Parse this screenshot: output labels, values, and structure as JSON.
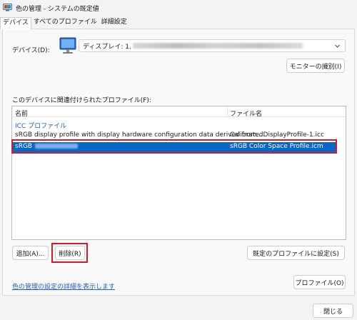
{
  "window": {
    "title": "色の管理 - システムの既定値"
  },
  "tabs": [
    {
      "label": "デバイス"
    },
    {
      "label": "すべてのプロファイル"
    },
    {
      "label": "詳細設定"
    }
  ],
  "device": {
    "label": "デバイス(D):",
    "value": "ディスプレイ: 1.",
    "identify_button": "モニターの識別(I)"
  },
  "profiles": {
    "label": "このデバイスに関連付けられたプロファイル(F):",
    "columns": {
      "name": "名前",
      "file": "ファイル名"
    },
    "group": "ICC プロファイル",
    "rows": [
      {
        "name": "sRGB display profile with display hardware configuration data derived from...",
        "file": "CalibratedDisplayProfile-1.icc"
      },
      {
        "name": "sRGB",
        "file": "sRGB Color Space Profile.icm"
      }
    ]
  },
  "buttons": {
    "add": "追加(A)...",
    "remove": "削除(R)",
    "set_default": "既定のプロファイルに設定(S)",
    "profile": "プロファイル(O)",
    "close": "閉じる"
  },
  "links": {
    "details": "色の管理の設定の詳細を表示します"
  },
  "colors": {
    "selection": "#0b67c6",
    "highlight_box": "#d01c2a",
    "link": "#1f5fbf"
  }
}
